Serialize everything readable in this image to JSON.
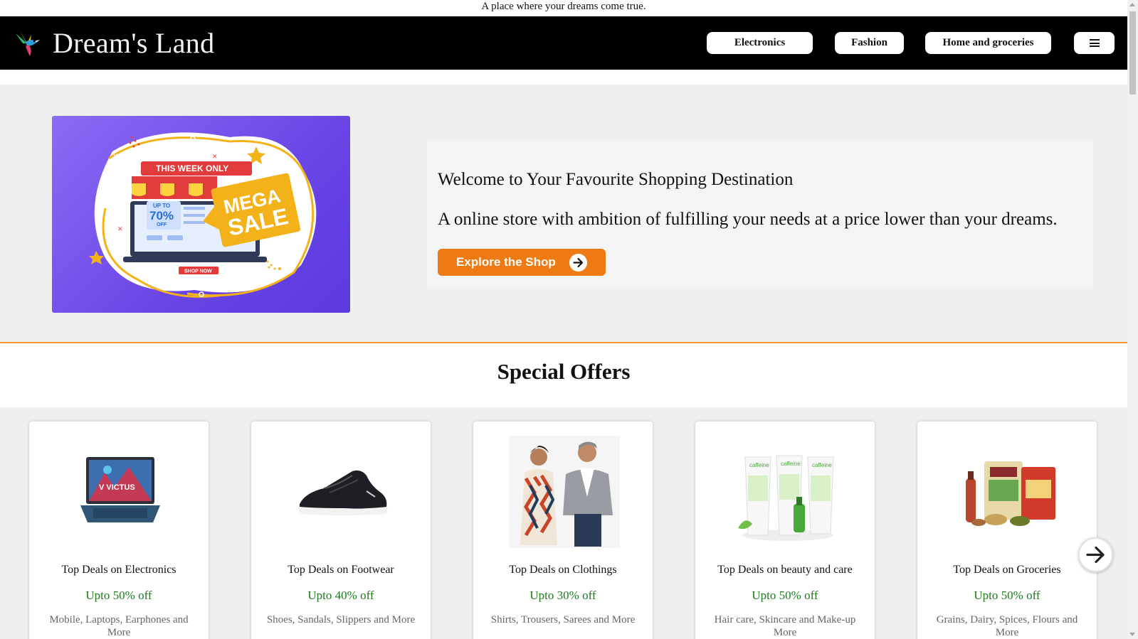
{
  "tagline": "A place where your dreams come true.",
  "header": {
    "brand": "Dream's Land",
    "logo_icon": "hummingbird-icon",
    "nav": [
      {
        "label": "Electronics"
      },
      {
        "label": "Fashion"
      },
      {
        "label": "Home and groceries"
      }
    ],
    "menu_icon": "hamburger-menu-icon"
  },
  "hero": {
    "banner": {
      "badge": "THIS WEEK ONLY",
      "headline_top": "MEGA",
      "headline_bottom": "SALE",
      "discount_prefix": "UP TO",
      "discount_value": "70%",
      "discount_suffix": "OFF",
      "cta": "SHOP NOW"
    },
    "heading": "Welcome to Your Favourite Shopping Destination",
    "subheading": "A online store with ambition of fulfilling your needs at a price lower than your dreams.",
    "cta_label": "Explore the Shop",
    "cta_icon": "arrow-right-icon"
  },
  "offers": {
    "title": "Special Offers",
    "items": [
      {
        "title": "Top Deals on Electronics",
        "discount": "Upto 50% off",
        "description": "Mobile, Laptops, Earphones and More",
        "image": "laptop-image"
      },
      {
        "title": "Top Deals on Footwear",
        "discount": "Upto 40% off",
        "description": "Shoes, Sandals, Slippers and More",
        "image": "sneaker-image"
      },
      {
        "title": "Top Deals on Clothings",
        "discount": "Upto 30% off",
        "description": "Shirts, Trousers, Sarees and More",
        "image": "couple-image"
      },
      {
        "title": "Top Deals on beauty and care",
        "discount": "Upto 50% off",
        "description": "Hair care, Skincare and Make-up More",
        "image": "skincare-image"
      },
      {
        "title": "Top Deals on Groceries",
        "discount": "Upto 50% off",
        "description": "Grains, Dairy, Spices, Flours and More",
        "image": "groceries-image"
      }
    ],
    "next_icon": "arrow-right-icon"
  },
  "colors": {
    "navbar": "#000000",
    "accent": "#ee7a13",
    "discount": "#1d7a1d",
    "banner_purple": "#6a45e6"
  }
}
